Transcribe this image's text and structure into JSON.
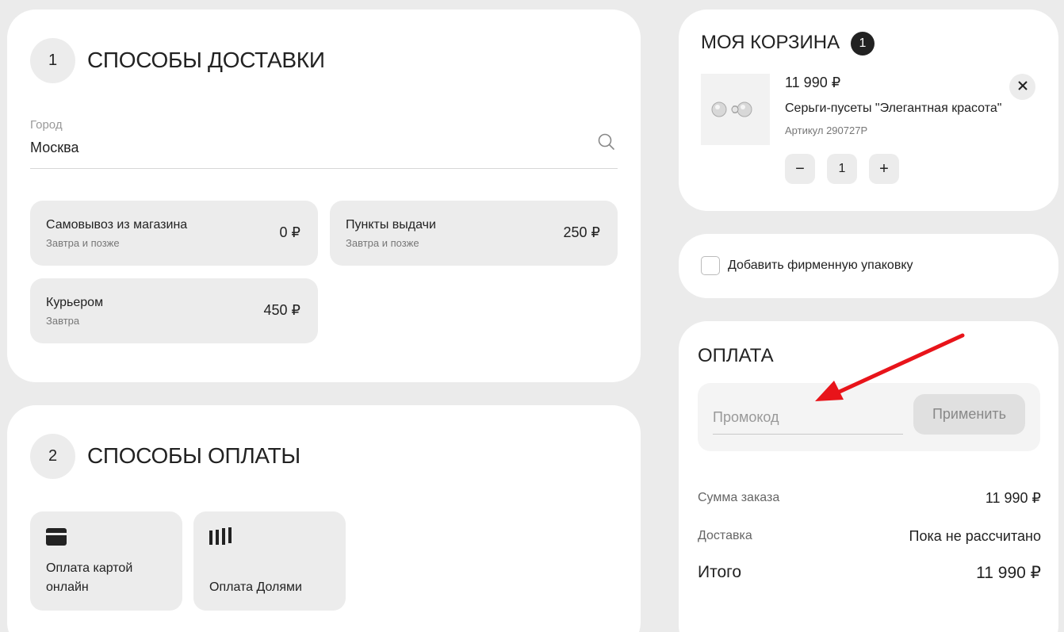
{
  "delivery": {
    "step": "1",
    "title": "СПОСОБЫ ДОСТАВКИ",
    "city_label": "Город",
    "city_value": "Москва",
    "options": [
      {
        "title": "Самовывоз из магазина",
        "subtitle": "Завтра и позже",
        "price": "0 ₽"
      },
      {
        "title": "Пункты выдачи",
        "subtitle": "Завтра и позже",
        "price": "250 ₽"
      },
      {
        "title": "Курьером",
        "subtitle": "Завтра",
        "price": "450 ₽"
      }
    ]
  },
  "payment_methods": {
    "step": "2",
    "title": "СПОСОБЫ ОПЛАТЫ",
    "options": [
      {
        "label": "Оплата картой онлайн",
        "icon": "credit-card-icon"
      },
      {
        "label": "Оплата Долями",
        "icon": "dolyami-icon"
      }
    ]
  },
  "cart": {
    "title": "МОЯ КОРЗИНА",
    "count": "1",
    "item": {
      "price": "11 990 ₽",
      "name": "Серьги-пусеты \"Элегантная красота\"",
      "sku": "Артикул 290727Р",
      "quantity": "1",
      "minus": "−",
      "plus": "+"
    }
  },
  "gift": {
    "label": "Добавить фирменную упаковку",
    "checked": false
  },
  "payment": {
    "title": "ОПЛАТА",
    "promo_placeholder": "Промокод",
    "apply_label": "Применить",
    "summary": [
      {
        "label": "Сумма заказа",
        "value": "11 990 ₽"
      },
      {
        "label": "Доставка",
        "value": "Пока не рассчитано"
      }
    ],
    "total_label": "Итого",
    "total_value": "11 990 ₽"
  },
  "colors": {
    "background": "#ebebeb",
    "card": "#ffffff",
    "option_bg": "#ececec",
    "annotation_arrow": "#e8141a"
  }
}
